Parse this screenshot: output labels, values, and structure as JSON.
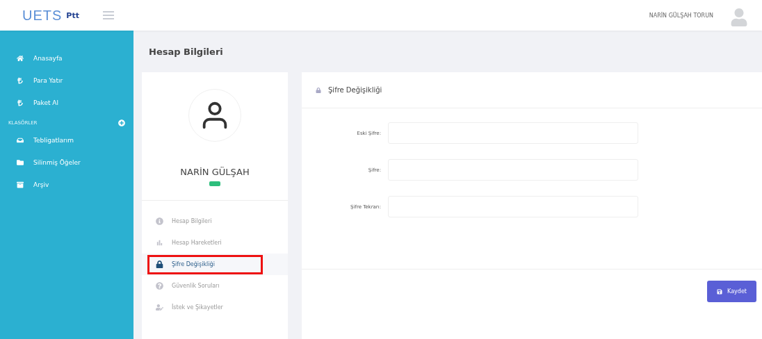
{
  "topbar": {
    "logo": "UETS",
    "logo_badge": "Ptt",
    "user_name": "NARİN GÜLŞAH TORUN"
  },
  "sidebar": {
    "items": [
      {
        "label": "Anasayfa",
        "kind": "home"
      },
      {
        "label": "Para Yatır",
        "kind": "money"
      },
      {
        "label": "Paket Al",
        "kind": "money"
      }
    ],
    "section": "KLASÖRLER",
    "folders": [
      {
        "label": "Tebligatlarım",
        "kind": "inbox"
      },
      {
        "label": "Silinmiş Öğeler",
        "kind": "folder"
      },
      {
        "label": "Arşiv",
        "kind": "archive"
      }
    ]
  },
  "page_title": "Hesap Bilgileri",
  "profile": {
    "name": "NARİN GÜLŞAH",
    "menu": [
      {
        "label": "Hesap Bilgileri",
        "kind": "info",
        "selected": false
      },
      {
        "label": "Hesap Hareketleri",
        "kind": "chart",
        "selected": false
      },
      {
        "label": "Şifre Değişikliği",
        "kind": "lock",
        "selected": true
      },
      {
        "label": "Güvenlik Soruları",
        "kind": "question",
        "selected": false
      },
      {
        "label": "İstek ve Şikayetler",
        "kind": "user",
        "selected": false
      }
    ]
  },
  "form": {
    "title": "Şifre Değişikliği",
    "fields": [
      {
        "label": "Eski Şifre:"
      },
      {
        "label": "Şifre:"
      },
      {
        "label": "Şifre Tekrarı:"
      }
    ],
    "submit": "Kaydet"
  }
}
